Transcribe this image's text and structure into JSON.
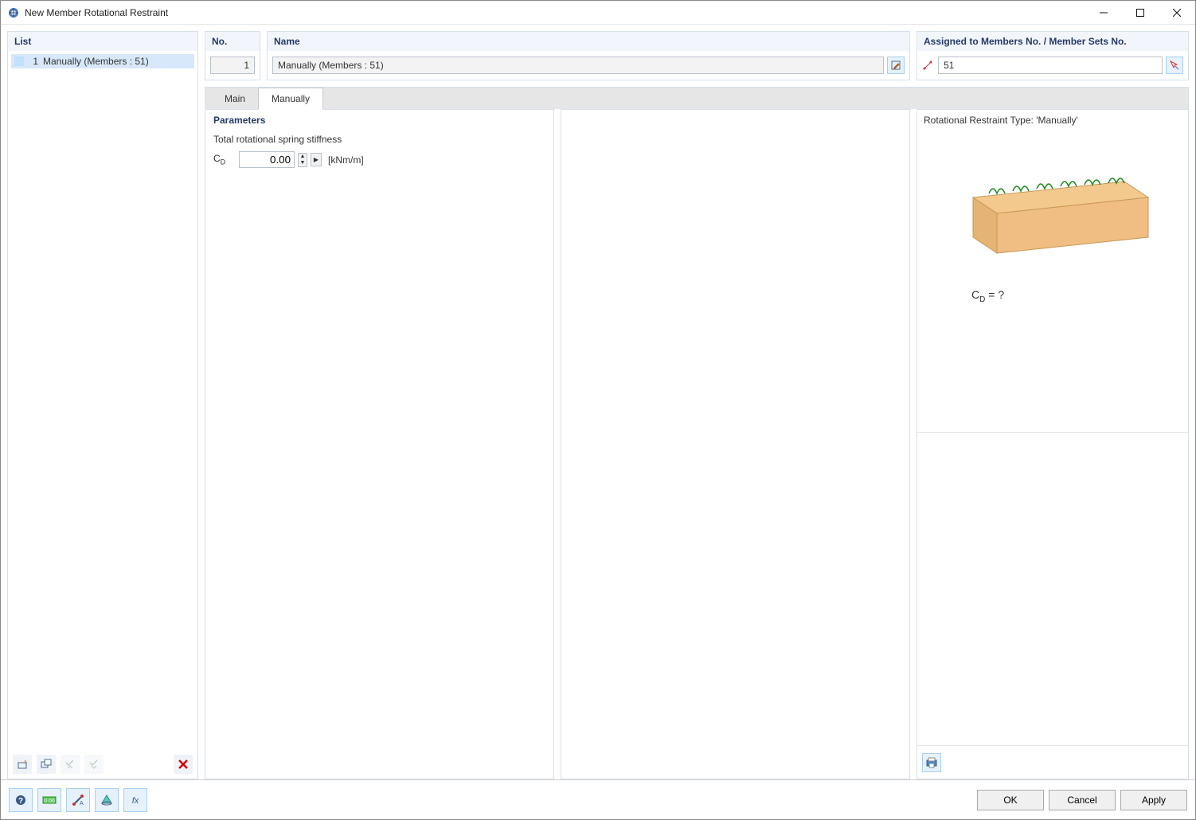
{
  "window": {
    "title": "New Member Rotational Restraint"
  },
  "list": {
    "heading": "List",
    "items": [
      {
        "num": "1",
        "label": "Manually (Members : 51)"
      }
    ]
  },
  "no": {
    "heading": "No.",
    "value": "1"
  },
  "name": {
    "heading": "Name",
    "value": "Manually (Members : 51)"
  },
  "assigned": {
    "heading": "Assigned to Members No. / Member Sets No.",
    "value": "51"
  },
  "tabs": {
    "main": "Main",
    "manually": "Manually"
  },
  "parameters": {
    "heading": "Parameters",
    "label": "Total rotational spring stiffness",
    "symbol": "C",
    "symbol_sub": "D",
    "value": "0.00",
    "unit": "[kNm/m]"
  },
  "preview": {
    "title": "Rotational Restraint Type: 'Manually'",
    "caption_sym": "C",
    "caption_sub": "D",
    "caption_rest": " = ?"
  },
  "buttons": {
    "ok": "OK",
    "cancel": "Cancel",
    "apply": "Apply"
  }
}
